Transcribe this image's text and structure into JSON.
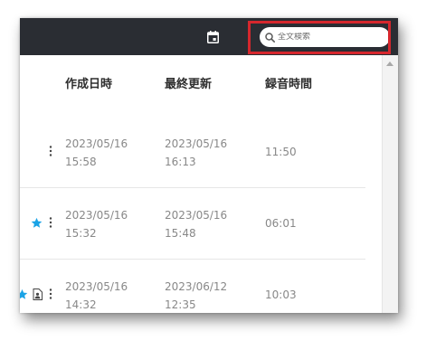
{
  "search": {
    "placeholder": "全文検索"
  },
  "toolbar": {
    "calendar_icon": "calendar-icon"
  },
  "table": {
    "columns": [
      "作成日時",
      "最終更新",
      "録音時間"
    ],
    "rows": [
      {
        "created_date": "2023/05/16",
        "created_time": "15:58",
        "updated_date": "2023/05/16",
        "updated_time": "16:13",
        "duration": "11:50",
        "starred": false,
        "has_document": false
      },
      {
        "created_date": "2023/05/16",
        "created_time": "15:32",
        "updated_date": "2023/05/16",
        "updated_time": "15:48",
        "duration": "06:01",
        "starred": true,
        "has_document": false
      },
      {
        "created_date": "2023/05/16",
        "created_time": "14:32",
        "updated_date": "2023/06/12",
        "updated_time": "12:35",
        "duration": "10:03",
        "starred": true,
        "has_document": true
      }
    ]
  },
  "colors": {
    "topbar": "#2a2d33",
    "highlight_border": "#d6272d",
    "star": "#1aa3e6",
    "header_text": "#2e2e2e",
    "cell_text": "#888888"
  }
}
